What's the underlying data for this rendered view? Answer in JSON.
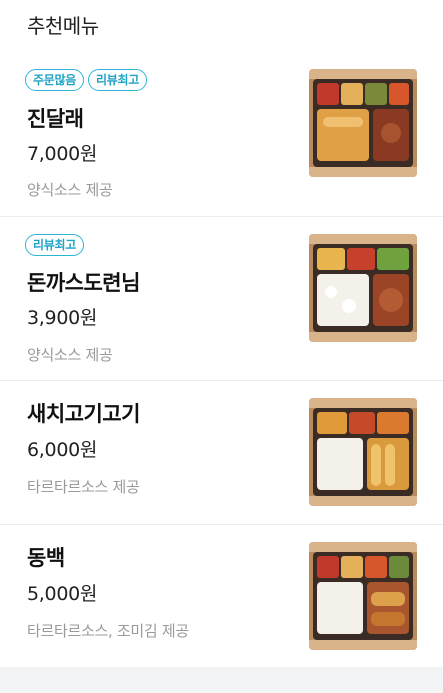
{
  "section": {
    "title": "추천메뉴"
  },
  "items": [
    {
      "badges": [
        "주문많음",
        "리뷰최고"
      ],
      "name": "진달래",
      "price": "7,000원",
      "desc": "양식소스 제공",
      "image_icon": "bento-box-icon"
    },
    {
      "badges": [
        "리뷰최고"
      ],
      "name": "돈까스도련님",
      "price": "3,900원",
      "desc": "양식소스 제공",
      "image_icon": "bento-box-icon"
    },
    {
      "badges": [],
      "name": "새치고기고기",
      "price": "6,000원",
      "desc": "타르타르소스 제공",
      "image_icon": "bento-box-icon"
    },
    {
      "badges": [],
      "name": "동백",
      "price": "5,000원",
      "desc": "타르타르소스, 조미김 제공",
      "image_icon": "bento-box-icon"
    }
  ],
  "colors": {
    "badge_border": "#2fb6d6",
    "badge_text": "#1fa3c6",
    "desc_text": "#9a9a9a"
  }
}
